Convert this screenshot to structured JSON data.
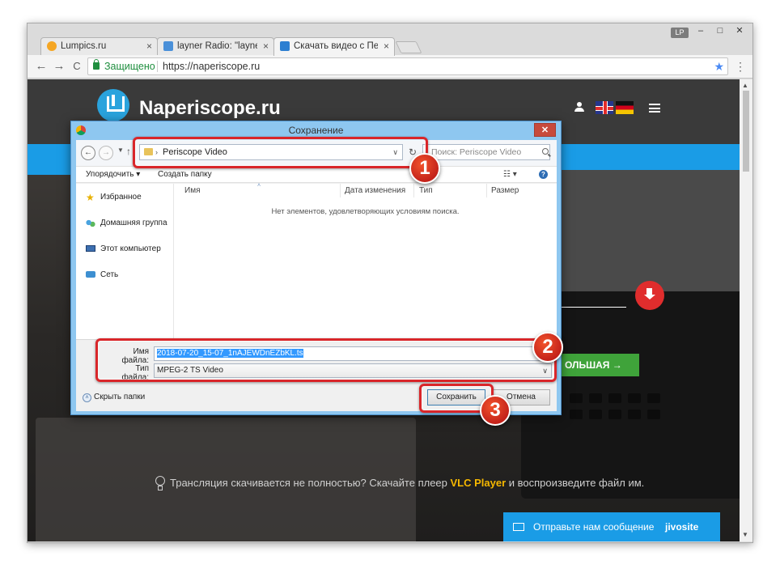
{
  "browser": {
    "tabs": [
      {
        "label": "Lumpics.ru",
        "close": "×",
        "color": "#f5a623"
      },
      {
        "label": "layner Radio: \"layner Radio\"",
        "close": "×",
        "color": "#4a90d9"
      },
      {
        "label": "Скачать видео с Перископ",
        "close": "×",
        "color": "#2d7fd1"
      }
    ],
    "profile_label": "LP",
    "window_controls": {
      "minimize": "–",
      "maximize": "□",
      "close": "✕"
    },
    "nav": {
      "back": "←",
      "forward": "→",
      "reload": "C",
      "menu": "⋮"
    },
    "omnibox": {
      "secure_label": "Защищено",
      "url": "https://naperiscope.ru",
      "star": "★"
    }
  },
  "site": {
    "logo_text": "Naperiscope.ru",
    "green_button_label": "ОЛЬШАЯ →",
    "tip": {
      "before": "Трансляция скачивается не полностью? Скачайте плеер ",
      "link": "VLC Player",
      "after": " и воспроизведите файл им."
    },
    "jivo": {
      "label": "Отправьте нам сообщение",
      "brand": "jivosite"
    }
  },
  "dialog": {
    "title": "Сохранение",
    "close": "✕",
    "address": {
      "chevron": "›",
      "path": "Periscope Video",
      "dropdown": "∨",
      "refresh": "↻"
    },
    "search_placeholder": "Поиск: Periscope Video",
    "commands": {
      "organize": "Упорядочить ▾",
      "new_folder": "Создать папку",
      "view": "☷ ▾",
      "help": "?"
    },
    "nav_items": [
      {
        "label": "Избранное",
        "icon": "star-icon"
      },
      {
        "label": "Домашняя группа",
        "icon": "homegroup-icon"
      },
      {
        "label": "Этот компьютер",
        "icon": "computer-icon"
      },
      {
        "label": "Сеть",
        "icon": "network-icon"
      }
    ],
    "columns": [
      "Имя",
      "Дата изменения",
      "Тип",
      "Размер"
    ],
    "empty_message": "Нет элементов, удовлетворяющих условиям поиска.",
    "filename_label": "Имя файла:",
    "filename_value": "2018-07-20_15-07_1nAJEWDnEZbKL.ts",
    "filetype_label": "Тип файла:",
    "filetype_value": "MPEG-2 TS Video",
    "dropdown_arrow": "∨",
    "hide_folders": "Скрыть папки",
    "hide_folders_icon": "˄",
    "save_button": "Сохранить",
    "cancel_button": "Отмена"
  },
  "callouts": [
    "1",
    "2",
    "3"
  ],
  "colors": {
    "accent_blue": "#1a9ce6",
    "callout_red": "#d9262a",
    "download_red": "#e02d2d",
    "green": "#3fa33a",
    "vlc_yellow": "#f6b800"
  }
}
